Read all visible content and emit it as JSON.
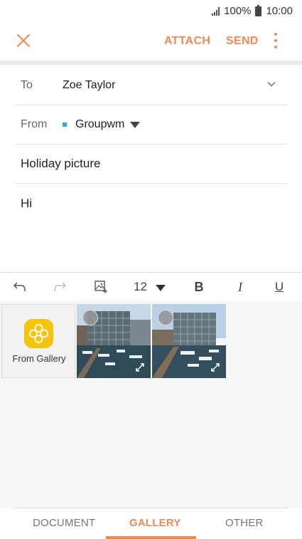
{
  "status": {
    "battery": "100%",
    "time": "10:00"
  },
  "appbar": {
    "attach_label": "ATTACH",
    "send_label": "SEND"
  },
  "compose": {
    "to_label": "To",
    "to_value": "Zoe Taylor",
    "from_label": "From",
    "from_value": "Groupwm",
    "subject": "Holiday picture",
    "body": "Hi"
  },
  "toolbar": {
    "font_size": "12",
    "bold": "B",
    "italic": "I",
    "underline": "U"
  },
  "tray": {
    "from_gallery_label": "From Gallery"
  },
  "tabs": [
    {
      "label": "DOCUMENT",
      "active": false
    },
    {
      "label": "GALLERY",
      "active": true
    },
    {
      "label": "OTHER",
      "active": false
    }
  ],
  "colors": {
    "accent": "#ee8a5a",
    "from_dot": "#37a8d6",
    "gallery_icon": "#f6c30d"
  },
  "icons": [
    "signal-icon",
    "battery-icon",
    "close-icon",
    "more-options-icon",
    "chevron-down-icon",
    "undo-icon",
    "redo-icon",
    "insert-image-icon",
    "gallery-app-icon",
    "expand-icon"
  ]
}
